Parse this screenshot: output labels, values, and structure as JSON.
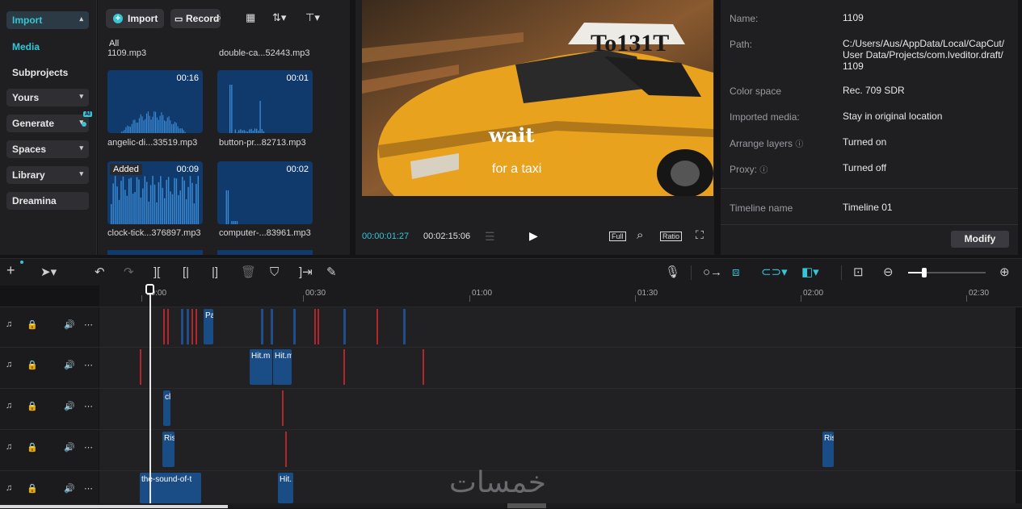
{
  "sidebar": {
    "import": "Import",
    "media": "Media",
    "subprojects": "Subprojects",
    "yours": "Yours",
    "generate": "Generate",
    "ai_badge": "AI",
    "spaces": "Spaces",
    "library": "Library",
    "dreamina": "Dreamina"
  },
  "media": {
    "import_button": "Import",
    "record_button": "Record",
    "filter_all": "All",
    "top_names": [
      "1109.mp3",
      "double-ca...52443.mp3"
    ],
    "items": [
      {
        "name": "angelic-di...33519.mp3",
        "duration": "00:16",
        "badge": ""
      },
      {
        "name": "button-pr...82713.mp3",
        "duration": "00:01",
        "badge": ""
      },
      {
        "name": "clock-tick...376897.mp3",
        "duration": "00:09",
        "badge": "Added"
      },
      {
        "name": "computer-...83961.mp3",
        "duration": "00:02",
        "badge": ""
      }
    ]
  },
  "player": {
    "caption_line1": "wait",
    "caption_line2": "for a taxi",
    "taxi_sign": "To131T",
    "current_time": "00:00:01:27",
    "total_time": "00:02:15:06",
    "full_label": "Full",
    "ratio_label": "Ratio"
  },
  "properties": {
    "name_label": "Name:",
    "name_value": "1109",
    "path_label": "Path:",
    "path_value_lines": [
      "C:/Users/Aus/AppData/Local/CapCut/",
      "User Data/Projects/com.lveditor.draft/",
      "1109"
    ],
    "color_space_label": "Color space",
    "color_space_value": "Rec. 709 SDR",
    "imported_media_label": "Imported media:",
    "imported_media_value": "Stay in original location",
    "arrange_layers_label": "Arrange layers",
    "arrange_layers_value": "Turned on",
    "proxy_label": "Proxy:",
    "proxy_value": "Turned off",
    "timeline_name_label": "Timeline name",
    "timeline_name_value": "Timeline 01",
    "modify_button": "Modify"
  },
  "timeline": {
    "ruler_labels": [
      "00:00",
      "00:30",
      "01:00",
      "01:30",
      "02:00",
      "02:30"
    ],
    "clips": {
      "t1": "Pa",
      "t2a": "Hit.m",
      "t2b": "Hit.m",
      "t3": "cl",
      "t4a": "Ris",
      "t4b": "Ris",
      "t5a": "the-sound-of-t",
      "t5b": "Hit."
    }
  },
  "watermark": "خمسات"
}
